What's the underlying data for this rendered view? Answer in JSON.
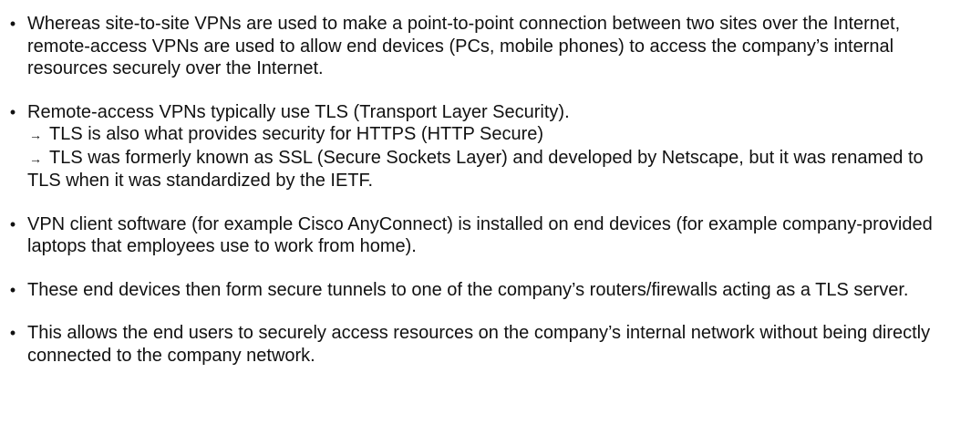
{
  "bullets": [
    {
      "marker": "•",
      "text": "Whereas site-to-site VPNs are used to make a point-to-point connection between two sites over the Internet, remote-access VPNs are used to allow end devices (PCs, mobile phones) to access the company’s internal resources securely over the Internet."
    },
    {
      "marker": "•",
      "text": "Remote-access VPNs typically use TLS (Transport Layer Security).",
      "subpoints": [
        {
          "arrow": "→",
          "text": "TLS is also what provides security for HTTPS (HTTP Secure)"
        },
        {
          "arrow": "→",
          "text": "TLS was formerly known as SSL (Secure Sockets Layer) and developed by Netscape, but it was renamed to TLS when it was standardized by the IETF."
        }
      ]
    },
    {
      "marker": "•",
      "text": "VPN client software (for example Cisco AnyConnect) is installed on end devices (for example company-provided laptops that employees use to work from home)."
    },
    {
      "marker": "•",
      "text": "These end devices then form secure tunnels to one of the company’s routers/firewalls acting as a TLS server."
    },
    {
      "marker": "•",
      "text": "This allows the end users to securely access resources on the company’s internal network without being directly connected to the company network."
    }
  ]
}
